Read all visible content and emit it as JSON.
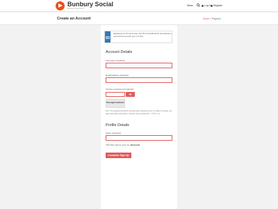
{
  "header": {
    "site_name": "Bunbury Social",
    "tagline": "Bunbury's best forum",
    "nav": {
      "news": "News",
      "login": "Log in",
      "register": "Register"
    }
  },
  "titlebar": {
    "title": "Create an Account",
    "breadcrumb": {
      "home": "Home",
      "separator": "»",
      "current": "Register"
    }
  },
  "notice": {
    "text": "Registering for this site is easy. Just fill in the fields below, and we'll get a new account set up for you in no time."
  },
  "account_details": {
    "heading": "Account Details",
    "username_label": "Username (required)",
    "username_value": "",
    "email_label": "Email Address (required)",
    "email_value": "",
    "password_label": "Choose a password (required)",
    "password_value": "",
    "strength_text": "Strength indicator",
    "hint": "Hint: The password should be at least twelve characters long. To make it stronger, use upper and lower case letters, numbers, and symbols like ! \" ? $ % ^ & )."
  },
  "profile_details": {
    "heading": "Profile Details",
    "name_label": "Name (required)",
    "name_value": "",
    "visibility_prefix": "This field may be seen by:",
    "visibility_value": "Everyone"
  },
  "submit_label": "Complete Sign Up",
  "colors": {
    "accent": "#e05b5b",
    "brand": "#e9501f",
    "notice_bar": "#3378b7",
    "background": "#f2f2f2"
  }
}
